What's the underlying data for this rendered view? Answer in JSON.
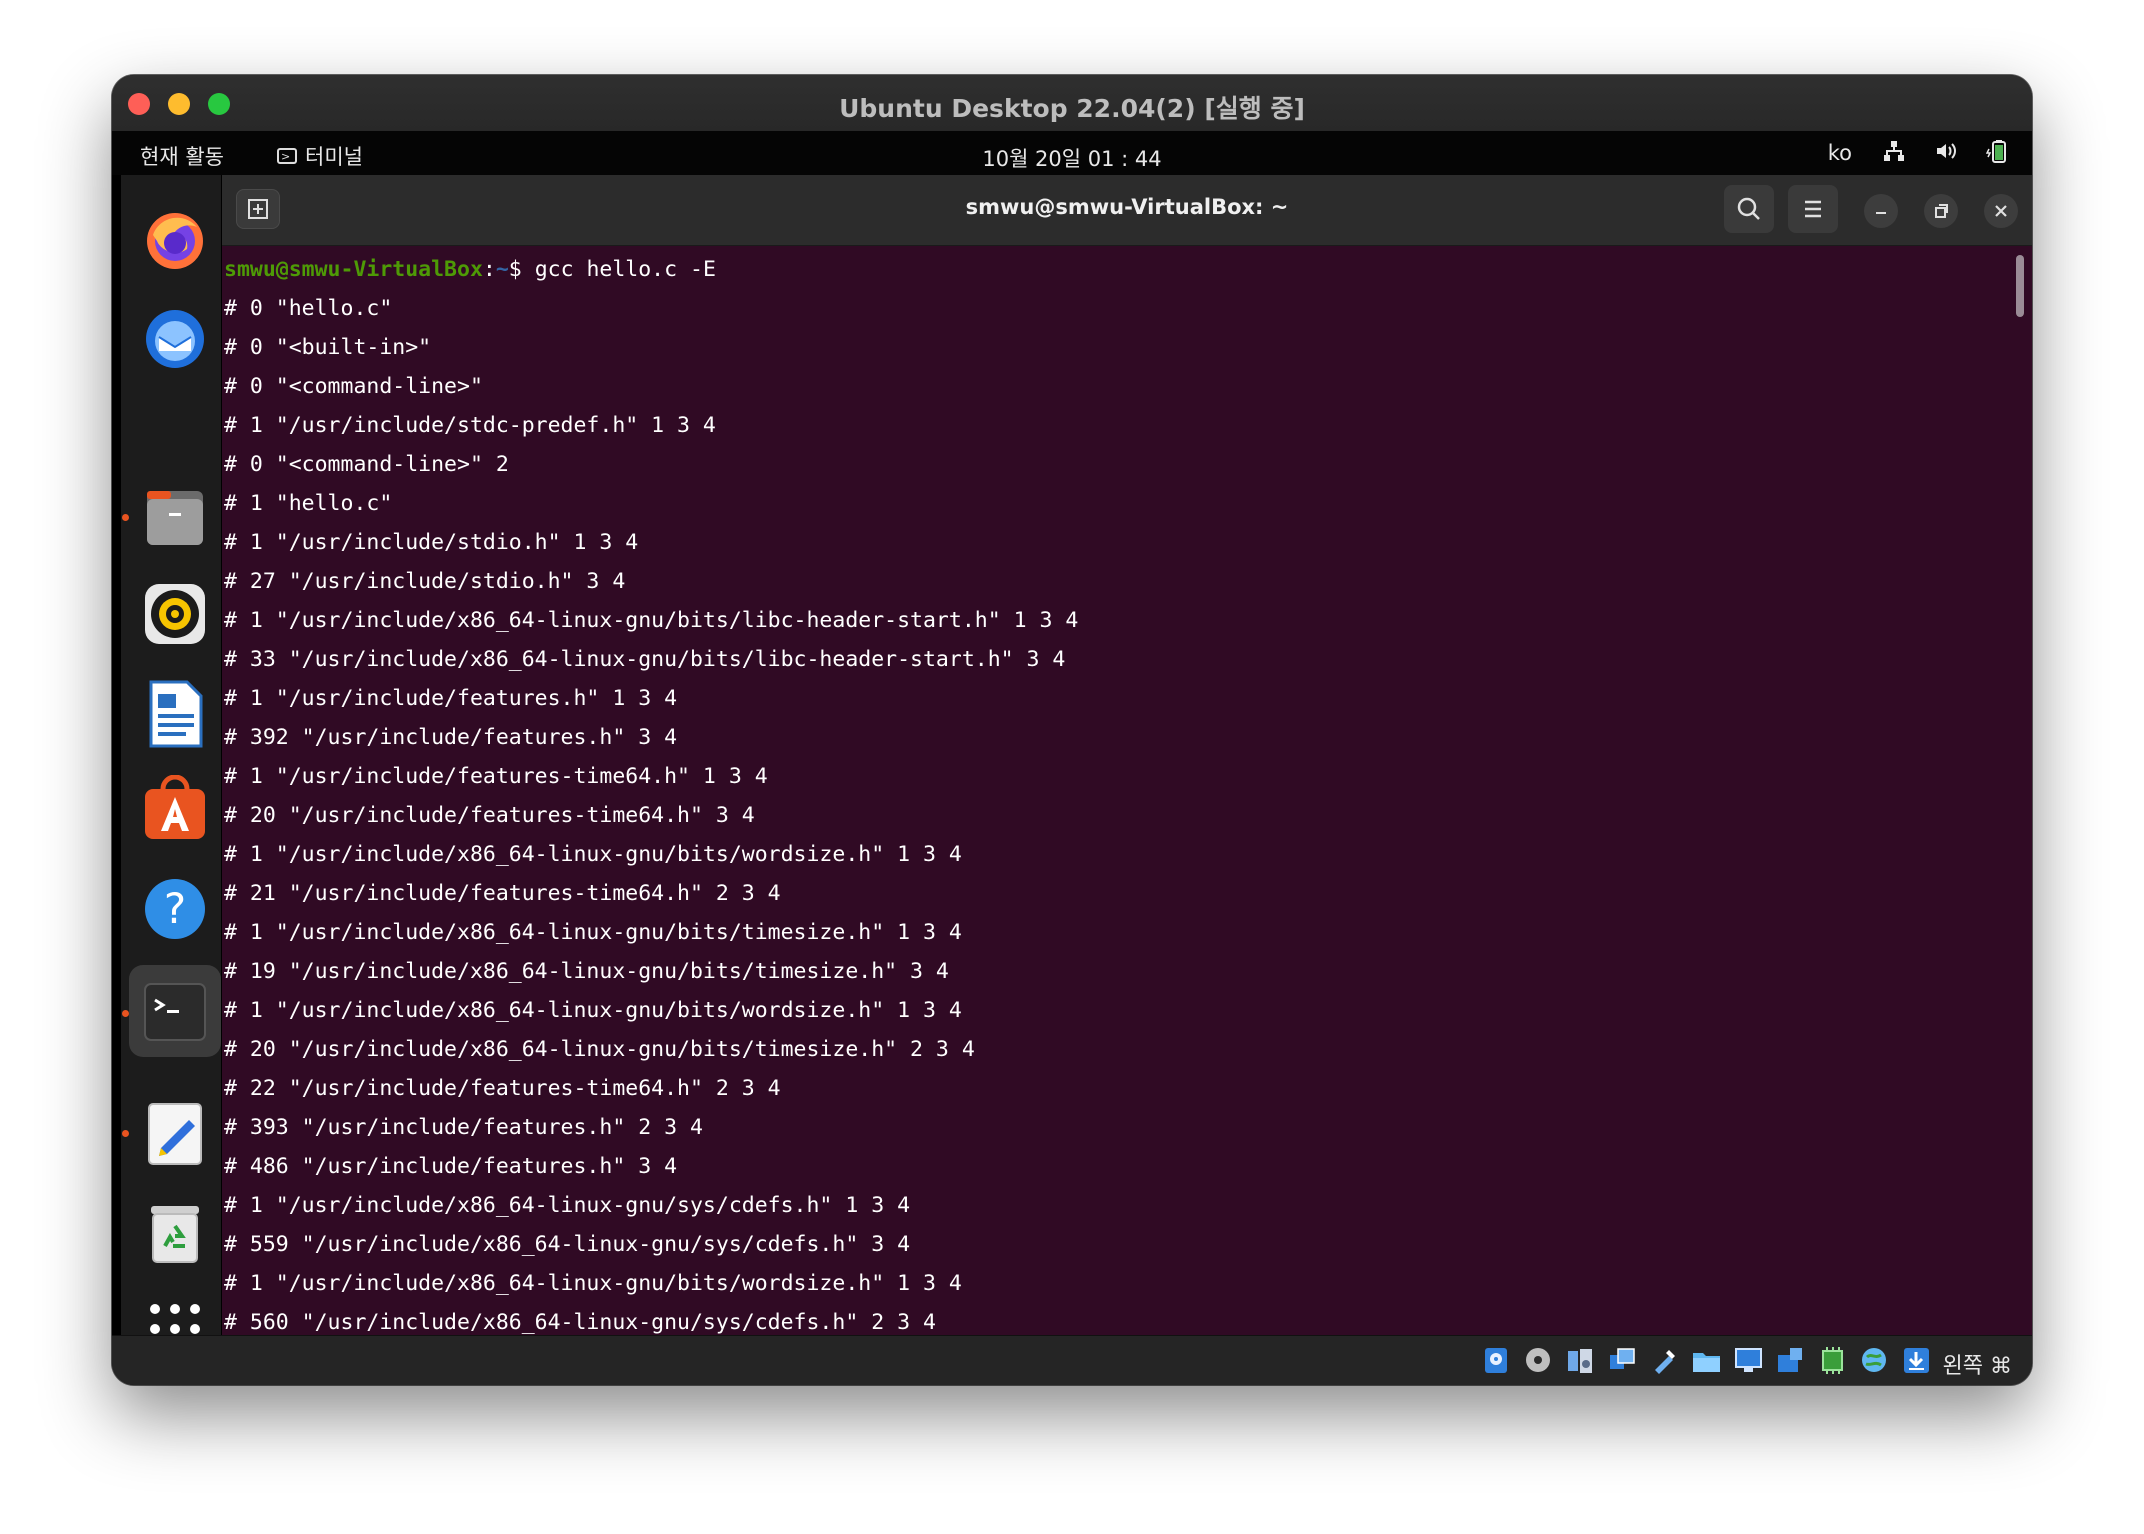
{
  "window": {
    "title": "Ubuntu Desktop 22.04(2) [실행 중]"
  },
  "topbar": {
    "activities": "현재 활동",
    "app_name": "터미널",
    "clock": "10월 20일  01 : 44",
    "input_lang": "ko",
    "icons": [
      "network-icon",
      "volume-icon",
      "battery-icon"
    ]
  },
  "dock": {
    "items": [
      {
        "name": "firefox-icon",
        "running": false
      },
      {
        "name": "thunderbird-icon",
        "running": false
      },
      {
        "name": "files-icon",
        "running": true
      },
      {
        "name": "rhythmbox-icon",
        "running": false
      },
      {
        "name": "libreoffice-writer-icon",
        "running": false
      },
      {
        "name": "app-center-icon",
        "running": false
      },
      {
        "name": "help-icon",
        "running": false
      },
      {
        "name": "terminal-icon",
        "running": true,
        "active": true
      },
      {
        "name": "text-editor-icon",
        "running": true
      },
      {
        "name": "trash-icon",
        "running": false
      },
      {
        "name": "show-apps-icon",
        "running": false
      }
    ]
  },
  "terminal": {
    "title": "smwu@smwu-VirtualBox: ~",
    "prompt": {
      "user_host": "smwu@smwu-VirtualBox",
      "colon": ":",
      "path": "~",
      "symbol": "$ ",
      "command": "gcc hello.c -E"
    },
    "output": [
      "# 0 \"hello.c\"",
      "# 0 \"<built-in>\"",
      "# 0 \"<command-line>\"",
      "# 1 \"/usr/include/stdc-predef.h\" 1 3 4",
      "# 0 \"<command-line>\" 2",
      "# 1 \"hello.c\"",
      "# 1 \"/usr/include/stdio.h\" 1 3 4",
      "# 27 \"/usr/include/stdio.h\" 3 4",
      "# 1 \"/usr/include/x86_64-linux-gnu/bits/libc-header-start.h\" 1 3 4",
      "# 33 \"/usr/include/x86_64-linux-gnu/bits/libc-header-start.h\" 3 4",
      "# 1 \"/usr/include/features.h\" 1 3 4",
      "# 392 \"/usr/include/features.h\" 3 4",
      "# 1 \"/usr/include/features-time64.h\" 1 3 4",
      "# 20 \"/usr/include/features-time64.h\" 3 4",
      "# 1 \"/usr/include/x86_64-linux-gnu/bits/wordsize.h\" 1 3 4",
      "# 21 \"/usr/include/features-time64.h\" 2 3 4",
      "# 1 \"/usr/include/x86_64-linux-gnu/bits/timesize.h\" 1 3 4",
      "# 19 \"/usr/include/x86_64-linux-gnu/bits/timesize.h\" 3 4",
      "# 1 \"/usr/include/x86_64-linux-gnu/bits/wordsize.h\" 1 3 4",
      "# 20 \"/usr/include/x86_64-linux-gnu/bits/timesize.h\" 2 3 4",
      "# 22 \"/usr/include/features-time64.h\" 2 3 4",
      "# 393 \"/usr/include/features.h\" 2 3 4",
      "# 486 \"/usr/include/features.h\" 3 4",
      "# 1 \"/usr/include/x86_64-linux-gnu/sys/cdefs.h\" 1 3 4",
      "# 559 \"/usr/include/x86_64-linux-gnu/sys/cdefs.h\" 3 4",
      "# 1 \"/usr/include/x86_64-linux-gnu/bits/wordsize.h\" 1 3 4",
      "# 560 \"/usr/include/x86_64-linux-gnu/sys/cdefs.h\" 2 3 4"
    ]
  },
  "vbox_status": {
    "host_key": "왼쪽 ⌘",
    "icons": [
      "hard-disk-icon",
      "optical-drive-icon",
      "audio-icon",
      "network-adapter-icon",
      "usb-icon",
      "shared-folders-icon",
      "display-icon",
      "recording-icon",
      "cpu-icon",
      "mouse-integration-icon",
      "keyboard-capture-icon"
    ]
  },
  "colors": {
    "terminal_bg": "#300a24",
    "prompt_user": "#4e9a06",
    "prompt_path": "#3465a4",
    "ubuntu_orange": "#e95420"
  }
}
